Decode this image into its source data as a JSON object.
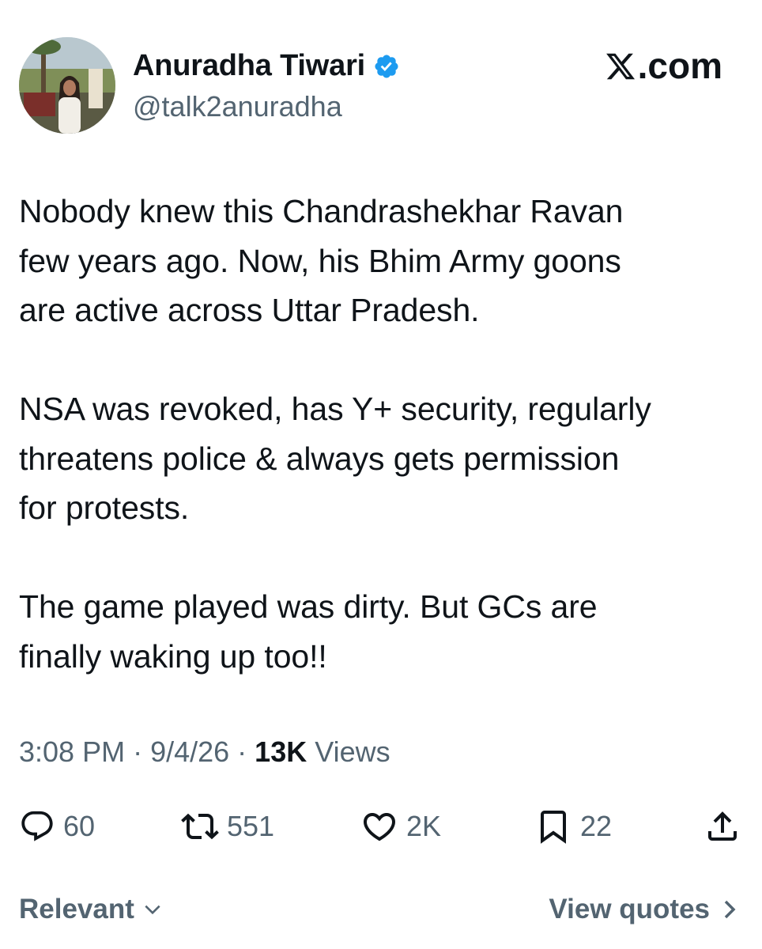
{
  "author": {
    "name": "Anuradha Tiwari",
    "handle": "@talk2anuradha",
    "verified": true
  },
  "brand": {
    "label": ".com"
  },
  "tweet": {
    "paragraphs": [
      "Nobody knew this Chandrashekhar Ravan\nfew years ago. Now, his Bhim Army goons\nare active across Uttar Pradesh.",
      "NSA was revoked, has Y+ security, regularly\nthreatens police & always gets permission\nfor protests.",
      "The game played was dirty. But GCs are\nfinally waking up too!!"
    ]
  },
  "meta": {
    "time": "3:08 PM",
    "separator": " · ",
    "date": "9/4/26",
    "views_count": "13K",
    "views_label": " Views"
  },
  "actions": {
    "replies": "60",
    "reposts": "551",
    "likes": "2K",
    "bookmarks": "22"
  },
  "footer": {
    "sort_label": "Relevant",
    "view_quotes_label": "View quotes"
  },
  "colors": {
    "text": "#0f1419",
    "secondary": "#536471",
    "verified_blue": "#1d9bf0"
  }
}
